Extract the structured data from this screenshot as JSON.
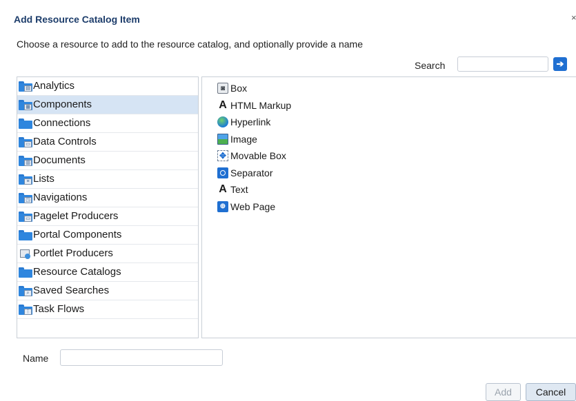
{
  "dialog": {
    "title": "Add Resource Catalog Item",
    "close_glyph": "×",
    "instructions": "Choose a resource to add to the resource catalog, and optionally provide a name"
  },
  "search": {
    "label": "Search",
    "value": "",
    "go_icon": "arrow-right-icon"
  },
  "categories": [
    {
      "label": "Analytics",
      "icon": "analytics-folder-icon",
      "selected": false
    },
    {
      "label": "Components",
      "icon": "components-folder-icon",
      "selected": true
    },
    {
      "label": "Connections",
      "icon": "folder-icon",
      "selected": false
    },
    {
      "label": "Data Controls",
      "icon": "data-controls-folder-icon",
      "selected": false
    },
    {
      "label": "Documents",
      "icon": "documents-folder-icon",
      "selected": false
    },
    {
      "label": "Lists",
      "icon": "lists-folder-icon",
      "selected": false
    },
    {
      "label": "Navigations",
      "icon": "navigations-folder-icon",
      "selected": false
    },
    {
      "label": "Pagelet Producers",
      "icon": "pagelet-folder-icon",
      "selected": false
    },
    {
      "label": "Portal Components",
      "icon": "folder-icon",
      "selected": false
    },
    {
      "label": "Portlet Producers",
      "icon": "portlet-producer-icon",
      "selected": false
    },
    {
      "label": "Resource Catalogs",
      "icon": "folder-icon",
      "selected": false
    },
    {
      "label": "Saved Searches",
      "icon": "saved-search-folder-icon",
      "selected": false
    },
    {
      "label": "Task Flows",
      "icon": "task-flows-folder-icon",
      "selected": false
    }
  ],
  "resources": [
    {
      "label": "Box",
      "icon": "box-icon"
    },
    {
      "label": "HTML Markup",
      "icon": "html-markup-icon"
    },
    {
      "label": "Hyperlink",
      "icon": "hyperlink-globe-icon"
    },
    {
      "label": "Image",
      "icon": "image-icon"
    },
    {
      "label": "Movable Box",
      "icon": "movable-box-icon"
    },
    {
      "label": "Separator",
      "icon": "separator-icon"
    },
    {
      "label": "Text",
      "icon": "text-icon"
    },
    {
      "label": "Web Page",
      "icon": "web-page-icon"
    }
  ],
  "name_field": {
    "label": "Name",
    "value": ""
  },
  "buttons": {
    "add": "Add",
    "cancel": "Cancel"
  },
  "colors": {
    "title": "#1d3d6b",
    "selected_row": "#d6e4f4",
    "accent": "#1f6fd1"
  }
}
